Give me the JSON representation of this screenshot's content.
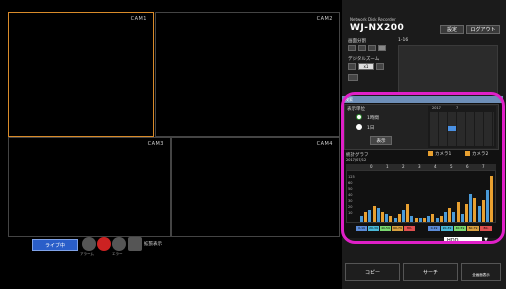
{
  "cameras": [
    {
      "label": "CAM1"
    },
    {
      "label": "CAM2"
    },
    {
      "label": "CAM3"
    },
    {
      "label": "CAM4"
    }
  ],
  "bottom": {
    "live_label": "ライブ中",
    "tool_labels": [
      "アラーム",
      "エラー",
      "",
      "拡張表示"
    ]
  },
  "header": {
    "subtitle": "Network Disk Recorder",
    "model": "WJ-NX200",
    "settings_label": "設定",
    "logout_label": "ログアウト"
  },
  "panel": {
    "split_label": "画面分割",
    "page_label": "1-16",
    "zoom_label": "デジタルズーム",
    "zoom_value": "x1"
  },
  "search": {
    "title": "検索",
    "unit_label": "表示単位",
    "opt_hour": "1時間",
    "opt_day": "1日",
    "display_btn": "表示",
    "cal_year": "2017",
    "cal_month": "7",
    "graph_label": "統計グラフ",
    "date_label": "2017/07/12",
    "cam1_label": "カメラ1",
    "cam2_label": "カメラ2",
    "hours": [
      "0",
      "1",
      "2",
      "3",
      "4",
      "5",
      "6",
      "7"
    ],
    "yticks": [
      "125",
      "60",
      "50",
      "40",
      "30",
      "20",
      "10"
    ],
    "bars": [
      3,
      5,
      6,
      8,
      7,
      5,
      4,
      3,
      2,
      4,
      6,
      9,
      3,
      2,
      2,
      2,
      3,
      4,
      2,
      3,
      5,
      7,
      5,
      10,
      4,
      9,
      14,
      12,
      8,
      11,
      16,
      23
    ],
    "legend1": [
      "0-19",
      "20-39",
      "40-59",
      "60-79",
      "80-"
    ],
    "legend2": [
      "0-19",
      "20-39",
      "40-59",
      "60-79",
      "80-"
    ],
    "hdd_label": "HDD"
  },
  "actions": {
    "copy_label": "コピー",
    "search_label": "サーチ",
    "more_label": "全画面表示"
  }
}
